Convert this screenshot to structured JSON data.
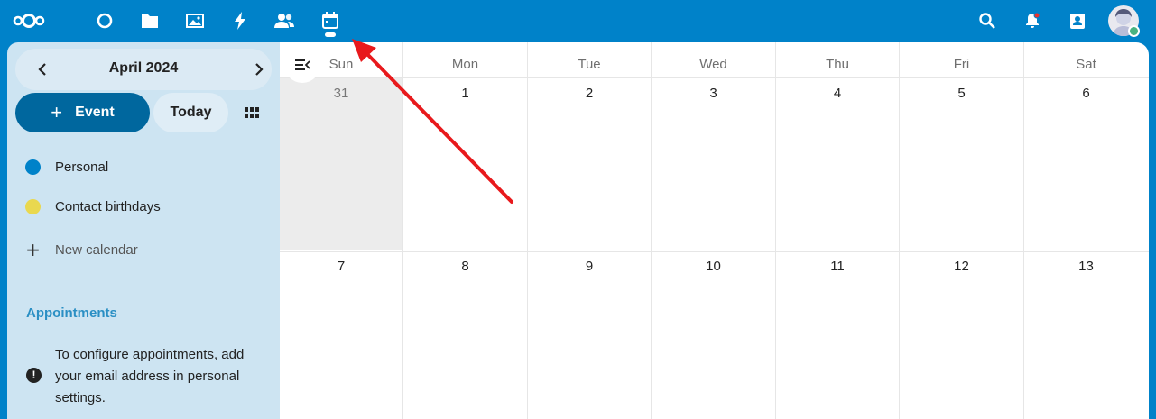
{
  "header": {
    "apps": [
      {
        "icon": "nextcloud-logo-icon"
      },
      {
        "icon": "dashboard-icon"
      },
      {
        "icon": "files-icon"
      },
      {
        "icon": "photos-icon"
      },
      {
        "icon": "activity-icon"
      },
      {
        "icon": "contacts-icon"
      },
      {
        "icon": "calendar-icon",
        "active": true
      }
    ],
    "right_icons": [
      "search-icon",
      "notifications-icon",
      "contacts-menu-icon",
      "user-avatar"
    ]
  },
  "sidebar": {
    "month_label": "April 2024",
    "new_event_label": "Event",
    "today_label": "Today",
    "calendars": [
      {
        "label": "Personal",
        "color": "#0082c9"
      },
      {
        "label": "Contact birthdays",
        "color": "#e9d84f"
      }
    ],
    "new_calendar_label": "New calendar",
    "appointments_heading": "Appointments",
    "appointments_note": "To configure appointments, add your email address in personal settings."
  },
  "calendar": {
    "weekdays": [
      "Sun",
      "Mon",
      "Tue",
      "Wed",
      "Thu",
      "Fri",
      "Sat"
    ],
    "weeks": [
      [
        "31",
        "1",
        "2",
        "3",
        "4",
        "5",
        "6"
      ],
      [
        "7",
        "8",
        "9",
        "10",
        "11",
        "12",
        "13"
      ]
    ]
  },
  "colors": {
    "brand": "#0082c9",
    "primary_button": "#00679e",
    "sidebar_bg": "#cde4f2",
    "annotation_arrow": "#e8191c"
  }
}
